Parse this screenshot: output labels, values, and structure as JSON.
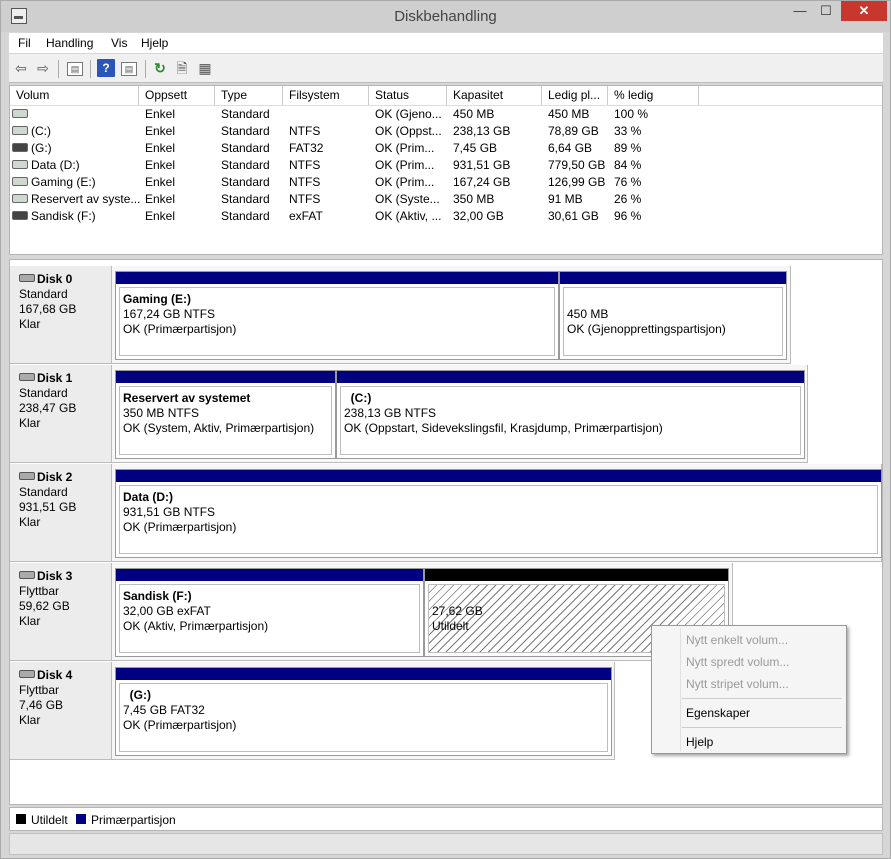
{
  "window": {
    "title": "Diskbehandling"
  },
  "menu": [
    "Fil",
    "Handling",
    "Vis",
    "Hjelp"
  ],
  "toolbar": {
    "back_icon": "arrow-left-icon",
    "forward_icon": "arrow-right-icon",
    "help_glyph": "?",
    "refresh_glyph": "↻"
  },
  "volume_list": {
    "headers": [
      "Volum",
      "Oppsett",
      "Type",
      "Filsystem",
      "Status",
      "Kapasitet",
      "Ledig pl...",
      "% ledig"
    ],
    "rows": [
      {
        "volum": "",
        "oppsett": "Enkel",
        "type": "Standard",
        "filsystem": "",
        "status": "OK (Gjeno...",
        "kapasitet": "450 MB",
        "ledig": "450 MB",
        "prosent": "100 %"
      },
      {
        "volum": "(C:)",
        "oppsett": "Enkel",
        "type": "Standard",
        "filsystem": "NTFS",
        "status": "OK (Oppst...",
        "kapasitet": "238,13 GB",
        "ledig": "78,89 GB",
        "prosent": "33 %"
      },
      {
        "volum": "(G:)",
        "oppsett": "Enkel",
        "type": "Standard",
        "filsystem": "FAT32",
        "status": "OK (Prim...",
        "kapasitet": "7,45 GB",
        "ledig": "6,64 GB",
        "prosent": "89 %"
      },
      {
        "volum": "Data (D:)",
        "oppsett": "Enkel",
        "type": "Standard",
        "filsystem": "NTFS",
        "status": "OK (Prim...",
        "kapasitet": "931,51 GB",
        "ledig": "779,50 GB",
        "prosent": "84 %"
      },
      {
        "volum": "Gaming (E:)",
        "oppsett": "Enkel",
        "type": "Standard",
        "filsystem": "NTFS",
        "status": "OK (Prim...",
        "kapasitet": "167,24 GB",
        "ledig": "126,99 GB",
        "prosent": "76 %"
      },
      {
        "volum": "Reservert av syste...",
        "oppsett": "Enkel",
        "type": "Standard",
        "filsystem": "NTFS",
        "status": "OK (Syste...",
        "kapasitet": "350 MB",
        "ledig": "91 MB",
        "prosent": "26 %"
      },
      {
        "volum": "Sandisk (F:)",
        "oppsett": "Enkel",
        "type": "Standard",
        "filsystem": "exFAT",
        "status": "OK (Aktiv, ...",
        "kapasitet": "32,00 GB",
        "ledig": "30,61 GB",
        "prosent": "96 %"
      }
    ]
  },
  "disks": [
    {
      "name": "Disk 0",
      "type": "Standard",
      "size": "167,68 GB",
      "state": "Klar",
      "partitions": [
        {
          "name": "Gaming  (E:)",
          "size": "167,24 GB NTFS",
          "status": "OK (Primærpartisjon)"
        },
        {
          "name": "",
          "size": "450 MB",
          "status": "OK (Gjenopprettingspartisjon)"
        }
      ]
    },
    {
      "name": "Disk 1",
      "type": "Standard",
      "size": "238,47 GB",
      "state": "Klar",
      "partitions": [
        {
          "name": "Reservert av systemet",
          "size": "350 MB NTFS",
          "status": "OK (System, Aktiv, Primærpartisjon)"
        },
        {
          "name": "(C:)",
          "size": "238,13 GB NTFS",
          "status": "OK (Oppstart, Sidevekslingsfil, Krasjdump, Primærpartisjon)"
        }
      ]
    },
    {
      "name": "Disk 2",
      "type": "Standard",
      "size": "931,51 GB",
      "state": "Klar",
      "partitions": [
        {
          "name": "Data  (D:)",
          "size": "931,51 GB NTFS",
          "status": "OK (Primærpartisjon)"
        }
      ]
    },
    {
      "name": "Disk 3",
      "type": "Flyttbar",
      "size": "59,62 GB",
      "state": "Klar",
      "partitions": [
        {
          "name": "Sandisk  (F:)",
          "size": "32,00 GB exFAT",
          "status": "OK (Aktiv, Primærpartisjon)"
        },
        {
          "name": "",
          "size": "27,62 GB",
          "status": "Utildelt"
        }
      ]
    },
    {
      "name": "Disk 4",
      "type": "Flyttbar",
      "size": "7,46 GB",
      "state": "Klar",
      "partitions": [
        {
          "name": "(G:)",
          "size": "7,45 GB FAT32",
          "status": "OK (Primærpartisjon)"
        }
      ]
    }
  ],
  "legend": {
    "unallocated": "Utildelt",
    "primary": "Primærpartisjon",
    "unallocated_color": "#000000",
    "primary_color": "#000080"
  },
  "context_menu": {
    "items": [
      "Nytt enkelt volum...",
      "Nytt spredt volum...",
      "Nytt stripet volum...",
      "Egenskaper",
      "Hjelp"
    ]
  }
}
